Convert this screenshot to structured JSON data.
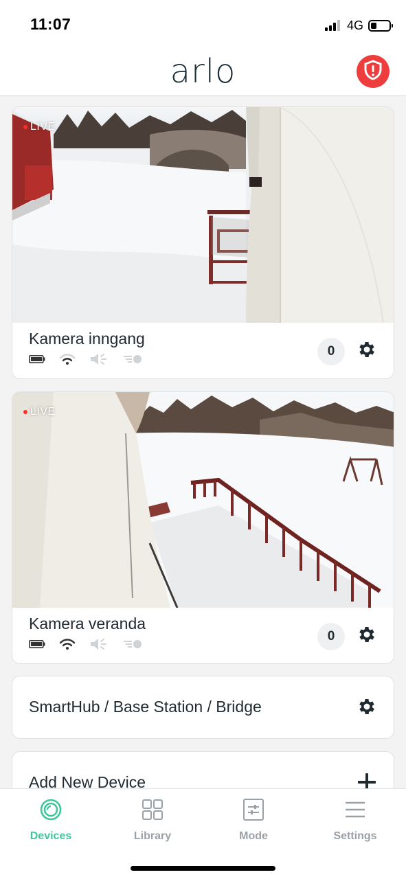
{
  "status_bar": {
    "time": "11:07",
    "network": "4G",
    "battery_level": 0.3
  },
  "header": {
    "logo": "arlo",
    "alert_icon": "shield-alert-icon",
    "alert_color": "#ee3d3d"
  },
  "cameras": [
    {
      "name": "Kamera inngang",
      "live_label": "LIVE",
      "event_count": "0",
      "status_icons": [
        "battery-icon",
        "wifi-icon",
        "speaker-muted-icon",
        "motion-toggle-icon"
      ]
    },
    {
      "name": "Kamera veranda",
      "live_label": "LIVE",
      "event_count": "0",
      "status_icons": [
        "battery-icon",
        "wifi-icon",
        "speaker-muted-icon",
        "motion-toggle-icon"
      ]
    }
  ],
  "smarthub": {
    "label": "SmartHub / Base Station / Bridge"
  },
  "add_device": {
    "label": "Add New Device"
  },
  "nav": {
    "items": [
      {
        "label": "Devices",
        "icon": "devices-icon",
        "active": true
      },
      {
        "label": "Library",
        "icon": "library-icon",
        "active": false
      },
      {
        "label": "Mode",
        "icon": "mode-icon",
        "active": false
      },
      {
        "label": "Settings",
        "icon": "settings-menu-icon",
        "active": false
      }
    ]
  },
  "colors": {
    "accent": "#3fc79a",
    "text": "#1f2a30",
    "inactive": "#9aa1a6",
    "live_dot": "#ff2d2d"
  }
}
